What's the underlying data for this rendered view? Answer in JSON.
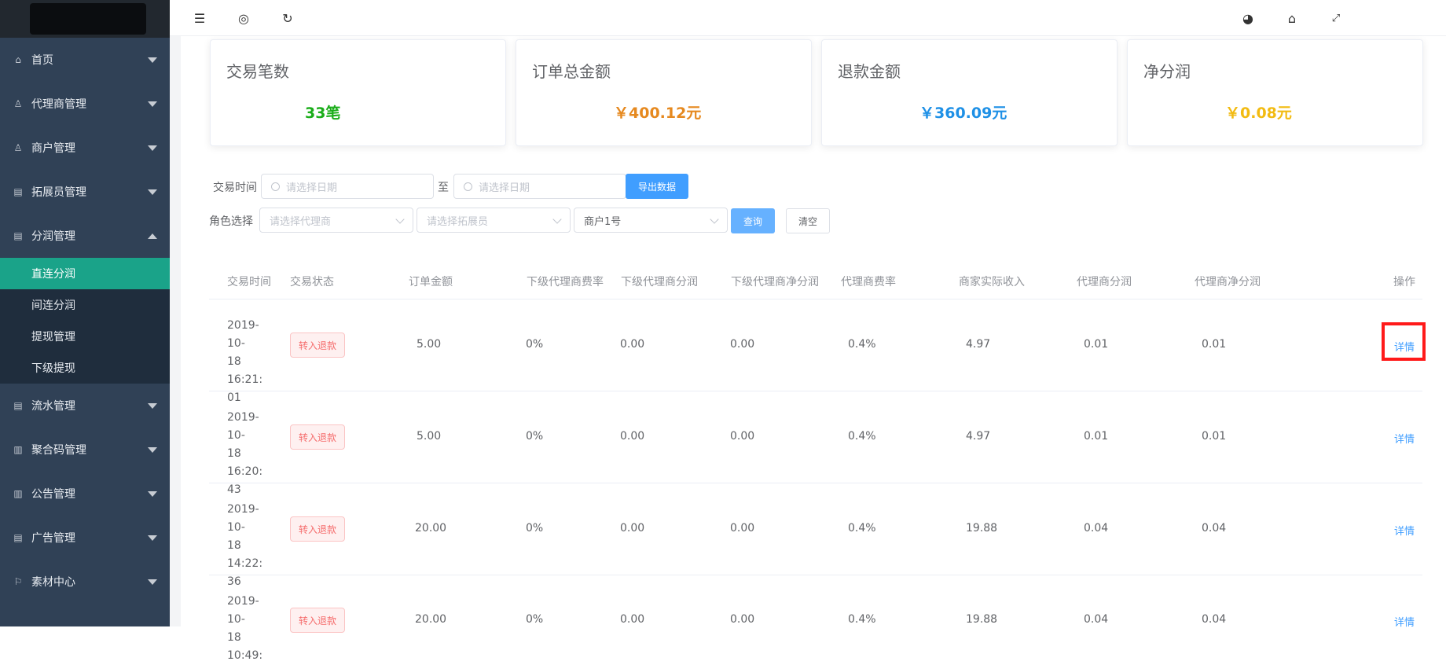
{
  "sidebar": {
    "items": [
      {
        "label": "首页",
        "icon": "home-icon",
        "expanded": false
      },
      {
        "label": "代理商管理",
        "icon": "user-icon",
        "expanded": false
      },
      {
        "label": "商户管理",
        "icon": "user-icon",
        "expanded": false
      },
      {
        "label": "拓展员管理",
        "icon": "clipboard-icon",
        "expanded": false
      },
      {
        "label": "分润管理",
        "icon": "clipboard-icon",
        "expanded": true,
        "children": [
          "直连分润",
          "间连分润",
          "提现管理",
          "下级提现"
        ],
        "active_child": "直连分润"
      },
      {
        "label": "流水管理",
        "icon": "clipboard-icon",
        "expanded": false
      },
      {
        "label": "聚合码管理",
        "icon": "chart-icon",
        "expanded": false
      },
      {
        "label": "公告管理",
        "icon": "chart-icon",
        "expanded": false
      },
      {
        "label": "广告管理",
        "icon": "clipboard-icon",
        "expanded": false
      },
      {
        "label": "素材中心",
        "icon": "flag-icon",
        "expanded": false
      }
    ]
  },
  "topbar": {
    "left_icons": [
      "menu-fold-icon",
      "globe-icon",
      "refresh-icon"
    ],
    "right_icons": [
      "palette-icon",
      "tag-icon",
      "fullscreen-icon"
    ]
  },
  "stats": [
    {
      "title": "交易笔数",
      "value": "33笔",
      "color": "#1aad19"
    },
    {
      "title": "订单总金额",
      "value": "￥400.12元",
      "color": "#e6891f"
    },
    {
      "title": "退款金额",
      "value": "￥360.09元",
      "color": "#1e90e6"
    },
    {
      "title": "净分润",
      "value": "￥0.08元",
      "color": "#f2bb12"
    }
  ],
  "filters": {
    "time_label": "交易时间",
    "date_placeholder": "请选择日期",
    "to_label": "至",
    "export_button": "导出数据",
    "role_label": "角色选择",
    "agent_placeholder": "请选择代理商",
    "promoter_placeholder": "请选择拓展员",
    "merchant_value": "商户1号",
    "query_button": "查询",
    "clear_button": "清空"
  },
  "table": {
    "headers": [
      "交易时间",
      "交易状态",
      "订单金额",
      "下级代理商费率",
      "下级代理商分润",
      "下级代理商净分润",
      "代理商费率",
      "商家实际收入",
      "代理商分润",
      "代理商净分润",
      "操作"
    ],
    "rows": [
      {
        "time": [
          "2019-10-",
          "18 16:21:",
          "01"
        ],
        "status": "转入退款",
        "amount": "5.00",
        "sub_rate": "0%",
        "sub_profit": "0.00",
        "sub_net": "0.00",
        "rate": "0.4%",
        "income": "4.97",
        "profit": "0.01",
        "net": "0.01",
        "action": "详情"
      },
      {
        "time": [
          "2019-10-",
          "18 16:20:",
          "43"
        ],
        "status": "转入退款",
        "amount": "5.00",
        "sub_rate": "0%",
        "sub_profit": "0.00",
        "sub_net": "0.00",
        "rate": "0.4%",
        "income": "4.97",
        "profit": "0.01",
        "net": "0.01",
        "action": "详情"
      },
      {
        "time": [
          "2019-10-",
          "18 14:22:",
          "36"
        ],
        "status": "转入退款",
        "amount": "20.00",
        "sub_rate": "0%",
        "sub_profit": "0.00",
        "sub_net": "0.00",
        "rate": "0.4%",
        "income": "19.88",
        "profit": "0.04",
        "net": "0.04",
        "action": "详情"
      },
      {
        "time": [
          "2019-10-",
          "18 10:49:",
          ""
        ],
        "status": "转入退款",
        "amount": "20.00",
        "sub_rate": "0%",
        "sub_profit": "0.00",
        "sub_net": "0.00",
        "rate": "0.4%",
        "income": "19.88",
        "profit": "0.04",
        "net": "0.04",
        "action": "详情"
      }
    ]
  }
}
